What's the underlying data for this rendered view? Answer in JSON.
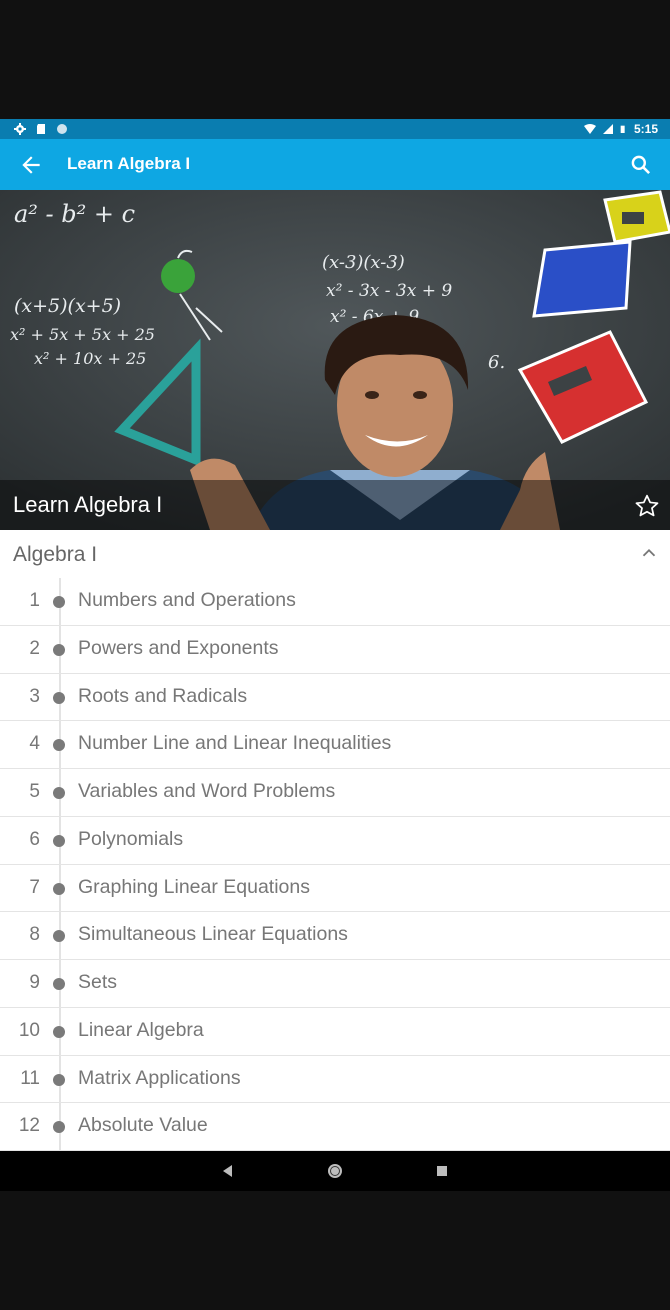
{
  "status_bar": {
    "time": "5:15",
    "icons_left": [
      "gear-icon",
      "sd-card-icon",
      "circle-icon"
    ],
    "icons_right": [
      "wifi-icon",
      "signal-icon",
      "battery-icon"
    ]
  },
  "app_bar": {
    "title": "Learn Algebra I",
    "back_icon": "arrow-back-icon",
    "search_icon": "search-icon"
  },
  "hero": {
    "caption": "Learn Algebra I",
    "favorite_icon": "star-outline-icon",
    "chalk": {
      "top_left": "a² - b² + c",
      "left_1": "(x+5)(x+5)",
      "left_2": "x² + 5x + 5x + 25",
      "left_3": "x² + 10x + 25",
      "mid_1": "(x-3)(x-3)",
      "mid_2": "x² - 3x - 3x + 9",
      "mid_3": "x² - 6x + 9",
      "six": "6."
    }
  },
  "section": {
    "title": "Algebra I",
    "chevron_icon": "chevron-up-icon"
  },
  "lessons": [
    {
      "num": "1",
      "title": "Numbers and Operations"
    },
    {
      "num": "2",
      "title": "Powers and Exponents"
    },
    {
      "num": "3",
      "title": "Roots and Radicals"
    },
    {
      "num": "4",
      "title": "Number Line and Linear Inequalities"
    },
    {
      "num": "5",
      "title": "Variables and Word Problems"
    },
    {
      "num": "6",
      "title": "Polynomials"
    },
    {
      "num": "7",
      "title": "Graphing Linear Equations"
    },
    {
      "num": "8",
      "title": "Simultaneous Linear Equations"
    },
    {
      "num": "9",
      "title": "Sets"
    },
    {
      "num": "10",
      "title": "Linear Algebra"
    },
    {
      "num": "11",
      "title": "Matrix Applications"
    },
    {
      "num": "12",
      "title": "Absolute Value"
    }
  ],
  "nav_bar": {
    "icons": [
      "nav-back-icon",
      "nav-home-icon",
      "nav-recents-icon"
    ]
  },
  "colors": {
    "status_bar": "#0a7db0",
    "app_bar": "#0ea7e3",
    "text_gray": "#777777"
  }
}
